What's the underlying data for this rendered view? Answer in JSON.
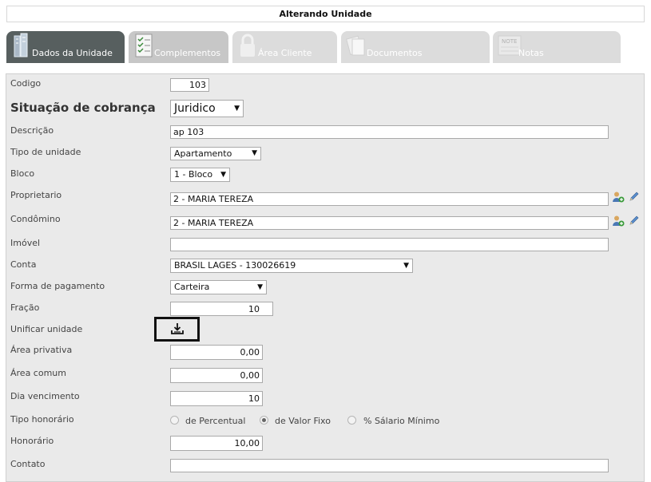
{
  "header": {
    "title": "Alterando Unidade"
  },
  "tabs": [
    {
      "label": "Dados da Unidade",
      "icon": "building-icon",
      "active": true
    },
    {
      "label": "Complementos",
      "icon": "checklist-icon",
      "active": false
    },
    {
      "label": "Área Cliente",
      "icon": "lock-icon",
      "active": false
    },
    {
      "label": "Documentos",
      "icon": "documents-icon",
      "active": false
    },
    {
      "label": "Notas",
      "icon": "note-icon",
      "active": false,
      "icon_text": "NOTE"
    }
  ],
  "form": {
    "codigo": {
      "label": "Codigo",
      "value": "103"
    },
    "situacao": {
      "label": "Situação de cobrança",
      "value": "Juridico"
    },
    "descricao": {
      "label": "Descrição",
      "value": "ap 103"
    },
    "tipo_unidade": {
      "label": "Tipo de unidade",
      "value": "Apartamento"
    },
    "bloco": {
      "label": "Bloco",
      "value": "1 - Bloco"
    },
    "proprietario": {
      "label": "Proprietario",
      "value": "2 - MARIA TEREZA"
    },
    "condomino": {
      "label": "Condômino",
      "value": "2 - MARIA TEREZA"
    },
    "imovel": {
      "label": "Imóvel",
      "value": ""
    },
    "conta": {
      "label": "Conta",
      "value": "BRASIL LAGES - 130026619"
    },
    "forma_pagamento": {
      "label": "Forma de pagamento",
      "value": "Carteira"
    },
    "fracao": {
      "label": "Fração",
      "value": "10"
    },
    "unificar": {
      "label": "Unificar unidade"
    },
    "area_privativa": {
      "label": "Área privativa",
      "value": "0,00"
    },
    "area_comum": {
      "label": "Área comum",
      "value": "0,00"
    },
    "dia_vencimento": {
      "label": "Dia vencimento",
      "value": "10"
    },
    "tipo_honorario": {
      "label": "Tipo honorário",
      "options": [
        "de Percentual",
        "de Valor Fixo",
        "% Sálario Mínimo"
      ],
      "selected": "de Valor Fixo"
    },
    "honorario": {
      "label": "Honorário",
      "value": "10,00"
    },
    "contato": {
      "label": "Contato",
      "value": ""
    }
  },
  "colors": {
    "active_tab": "#575f5f",
    "inactive_tab": "#dcdcdc",
    "form_bg": "#eaeaea"
  }
}
